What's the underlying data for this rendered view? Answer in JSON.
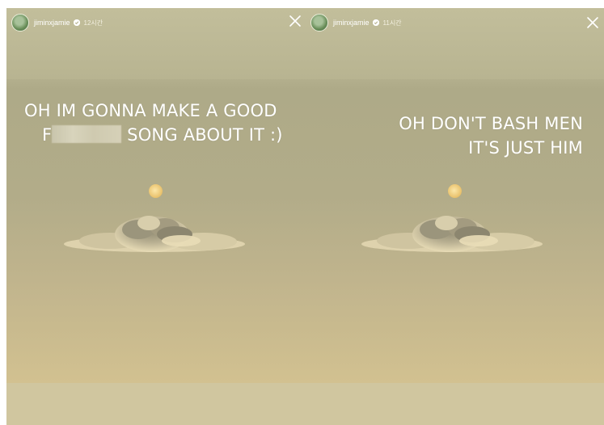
{
  "stories": [
    {
      "username": "jiminxjamie",
      "time": "12시간",
      "caption_line1": "OH IM GONNA MAKE A GOOD",
      "caption_line2_prefix": "F",
      "caption_line2_suffix": "SONG ABOUT IT :)"
    },
    {
      "username": "jiminxjamie",
      "time": "11시간",
      "caption_line1": "OH DON'T BASH MEN",
      "caption_line2": "IT'S JUST HIM"
    }
  ],
  "icons": {
    "close": "close-icon",
    "verified": "verified-badge-icon",
    "avatar": "avatar"
  },
  "colors": {
    "sky_top": "#bdb996",
    "sky_bottom": "#d9c794",
    "moon": "#e8c06a",
    "text": "#ffffff"
  }
}
